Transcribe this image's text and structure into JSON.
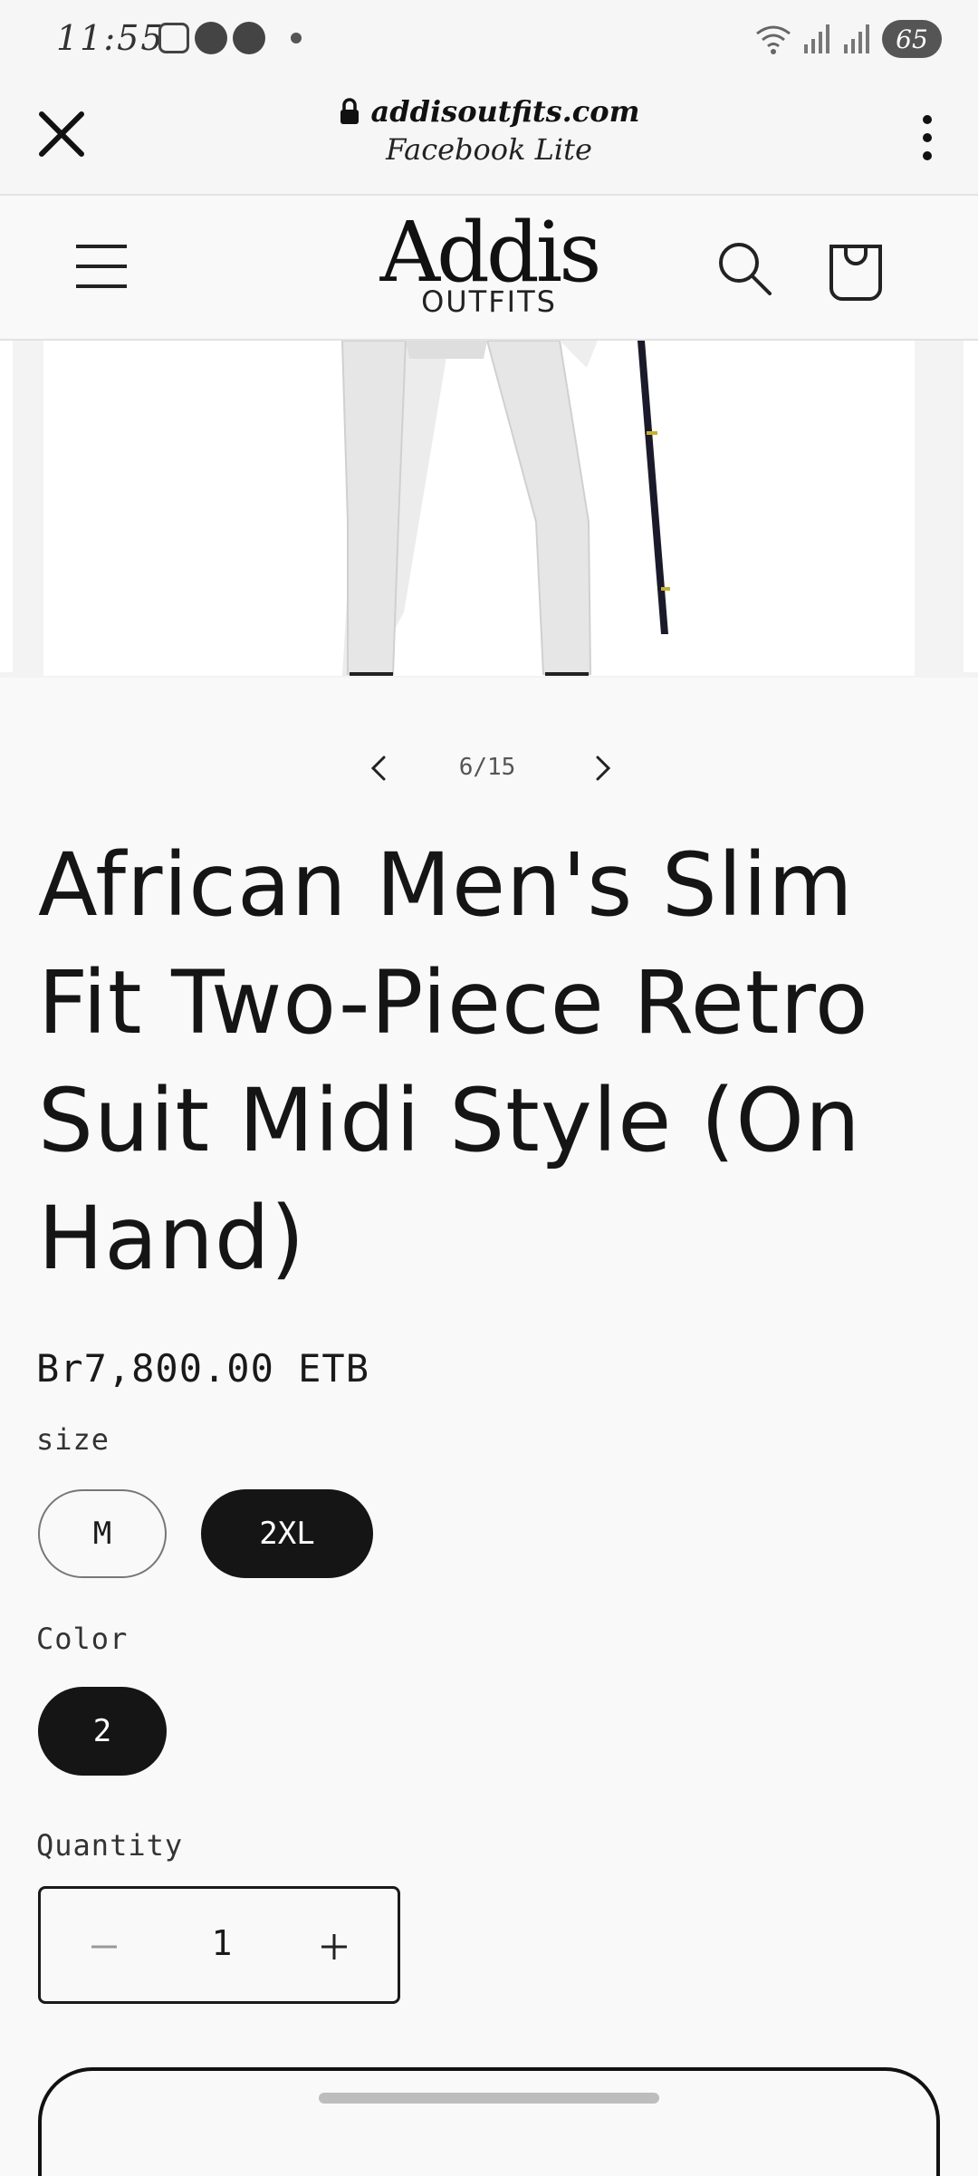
{
  "status_bar": {
    "time": "11:55",
    "battery": "65"
  },
  "browser": {
    "url": "addisoutfits.com",
    "subtitle": "Facebook Lite"
  },
  "header": {
    "logo_main": "Addis",
    "logo_sub": "OUTFITS"
  },
  "gallery": {
    "counter": "6/15"
  },
  "product": {
    "title": "African Men's Slim Fit Two-Piece Retro Suit Midi Style (On Hand)",
    "price": "Br7,800.00 ETB"
  },
  "options": {
    "size_label": "size",
    "sizes": [
      {
        "label": "M",
        "selected": false
      },
      {
        "label": "2XL",
        "selected": true
      }
    ],
    "color_label": "Color",
    "colors": [
      {
        "label": "2",
        "selected": true
      }
    ]
  },
  "quantity": {
    "label": "Quantity",
    "value": "1"
  },
  "colors": {
    "background": "#f9f9f9",
    "text": "#151515",
    "selected_pill": "#151515"
  },
  "icons": [
    "close-icon",
    "lock-icon",
    "more-vert-icon",
    "menu-icon",
    "search-icon",
    "cart-icon",
    "chevron-left-icon",
    "chevron-right-icon",
    "minus-icon",
    "plus-icon"
  ]
}
